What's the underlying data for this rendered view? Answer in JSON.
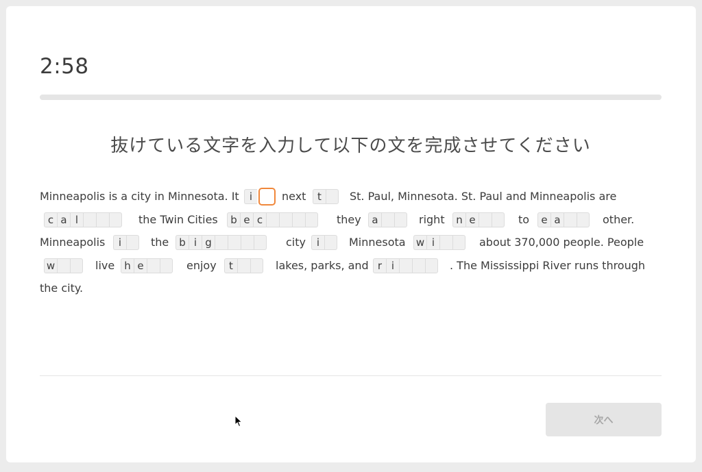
{
  "timer": "2:58",
  "progress_fraction": 0,
  "instruction": "抜けている文字を入力して以下の文を完成させてください",
  "passage": {
    "line1": {
      "t1": "Minneapolis is a city in Minnesota. It",
      "b1": [
        "i",
        ""
      ],
      "t2": "next",
      "b2": [
        "t",
        ""
      ],
      "t3": "St. Paul, Minnesota. St. Paul and Minneapolis are"
    },
    "line2": {
      "b1": [
        "c",
        "a",
        "l",
        "",
        "",
        ""
      ],
      "t1": "the Twin Cities",
      "b2": [
        "b",
        "e",
        "c",
        "",
        "",
        "",
        ""
      ],
      "t2": "they",
      "b3": [
        "a",
        "",
        ""
      ],
      "t3": "right",
      "b4": [
        "n",
        "e",
        "",
        ""
      ],
      "t4": "to",
      "b5": [
        "e",
        "a",
        "",
        ""
      ],
      "t5": "other."
    },
    "line3": {
      "t1": "Minneapolis",
      "b1": [
        "i",
        ""
      ],
      "t2": "the",
      "b2": [
        "b",
        "i",
        "g",
        "",
        "",
        "",
        ""
      ],
      "t3": "city",
      "b3": [
        "i",
        ""
      ],
      "t4": "Minnesota",
      "b4": [
        "w",
        "i",
        "",
        ""
      ],
      "t5": "about 370,000 people. People"
    },
    "line4": {
      "b1": [
        "w",
        "",
        ""
      ],
      "t1": "live",
      "b2": [
        "h",
        "e",
        "",
        ""
      ],
      "t2": "enjoy",
      "b3": [
        "t",
        "",
        ""
      ],
      "t3": "lakes, parks, and",
      "b4": [
        "r",
        "i",
        "",
        "",
        ""
      ],
      "t4": ". The Mississippi River runs through"
    },
    "line5": {
      "t1": "the city."
    }
  },
  "next_button_label": "次へ",
  "colors": {
    "active_border": "#f0873a",
    "button_bg": "#e5e5e5",
    "button_text": "#a7a7a7"
  }
}
